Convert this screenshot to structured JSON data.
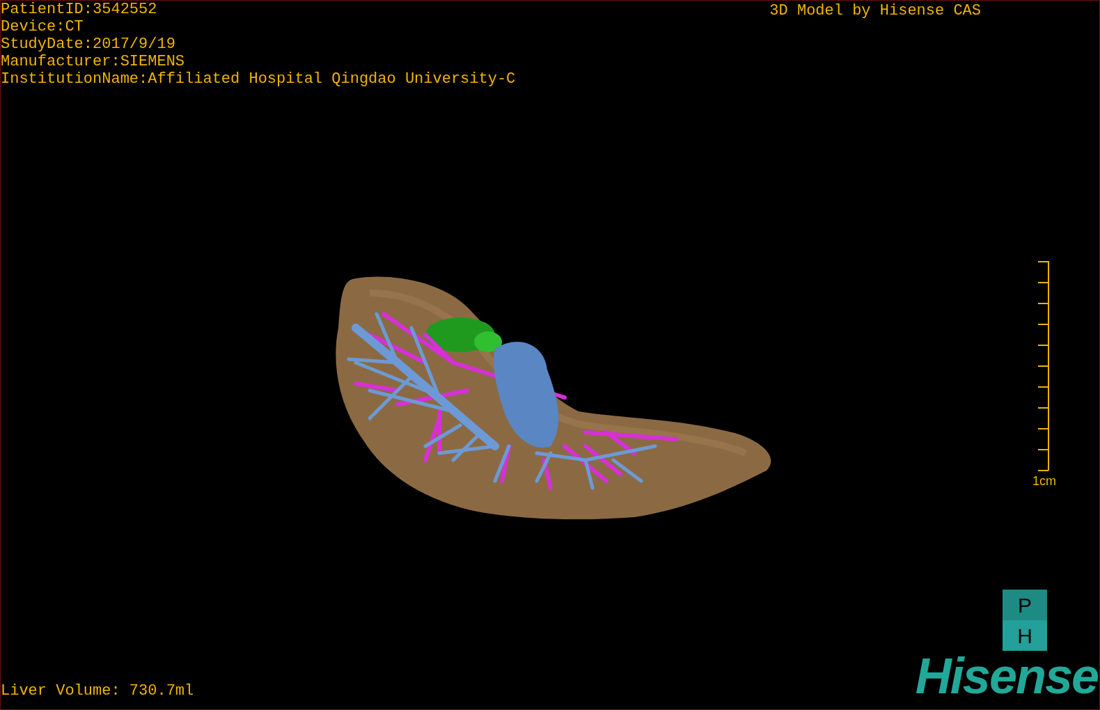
{
  "info_lines": [
    "PatientID:3542552",
    "Device:CT",
    "StudyDate:2017/9/19",
    "Manufacturer:SIEMENS",
    "InstitutionName:Affiliated Hospital Qingdao University-C"
  ],
  "title": "3D Model by Hisense CAS",
  "scale_bar": {
    "label": "1cm"
  },
  "liver_volume": "Liver Volume: 730.7ml",
  "logo": {
    "badge": [
      "P",
      "H"
    ],
    "wordmark": "Hisense"
  }
}
